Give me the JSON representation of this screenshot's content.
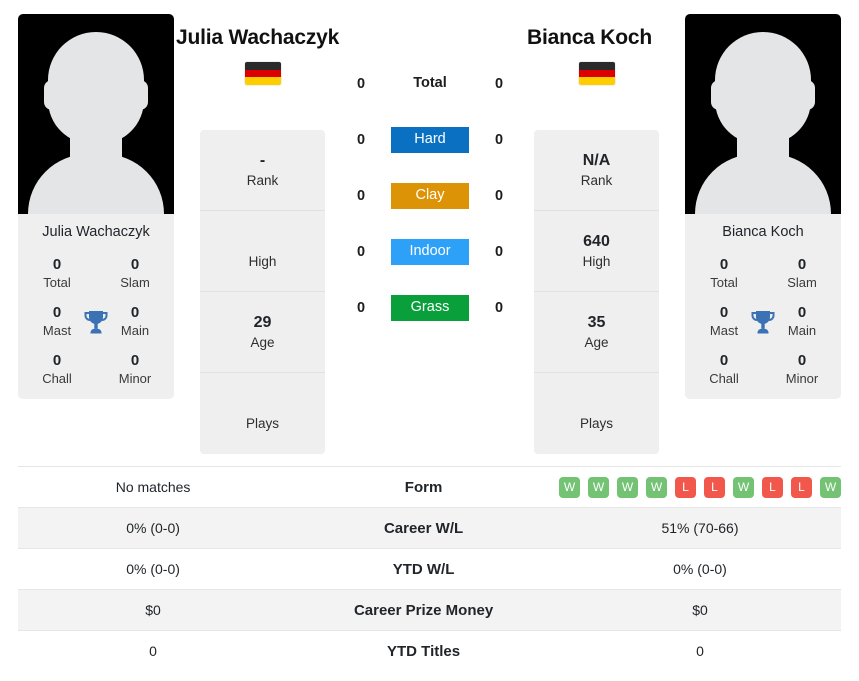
{
  "players": {
    "left": {
      "name": "Julia Wachaczyk",
      "photo_caption": "Julia Wachaczyk",
      "flag": "germany-flag",
      "avatar": "player-silhouette-avatar",
      "titles": [
        {
          "value": "0",
          "label": "Total"
        },
        {
          "value": "0",
          "label": "Slam"
        },
        {
          "value": "0",
          "label": "Mast"
        },
        {
          "value": "0",
          "label": "Main"
        },
        {
          "value": "0",
          "label": "Chall"
        },
        {
          "value": "0",
          "label": "Minor"
        }
      ],
      "info": [
        {
          "value": "-",
          "label": "Rank"
        },
        {
          "value": "",
          "label": "High"
        },
        {
          "value": "29",
          "label": "Age"
        },
        {
          "value": "",
          "label": "Plays"
        }
      ]
    },
    "right": {
      "name": "Bianca Koch",
      "photo_caption": "Bianca Koch",
      "flag": "germany-flag",
      "avatar": "player-silhouette-avatar",
      "titles": [
        {
          "value": "0",
          "label": "Total"
        },
        {
          "value": "0",
          "label": "Slam"
        },
        {
          "value": "0",
          "label": "Mast"
        },
        {
          "value": "0",
          "label": "Main"
        },
        {
          "value": "0",
          "label": "Chall"
        },
        {
          "value": "0",
          "label": "Minor"
        }
      ],
      "info": [
        {
          "value": "N/A",
          "label": "Rank"
        },
        {
          "value": "640",
          "label": "High"
        },
        {
          "value": "35",
          "label": "Age"
        },
        {
          "value": "",
          "label": "Plays"
        }
      ]
    }
  },
  "surfaces": [
    {
      "label": "Total",
      "left": "0",
      "right": "0",
      "color": "transparent",
      "style": "plain"
    },
    {
      "label": "Hard",
      "left": "0",
      "right": "0",
      "color": "#0a71c2",
      "style": "badge"
    },
    {
      "label": "Clay",
      "left": "0",
      "right": "0",
      "color": "#dd9306",
      "style": "badge"
    },
    {
      "label": "Indoor",
      "left": "0",
      "right": "0",
      "color": "#2da1f8",
      "style": "badge"
    },
    {
      "label": "Grass",
      "left": "0",
      "right": "0",
      "color": "#09a03b",
      "style": "badge"
    }
  ],
  "stats_rows": [
    {
      "label": "Form",
      "left_text": "No matches",
      "right_text": "",
      "right_form": [
        "W",
        "W",
        "W",
        "W",
        "L",
        "L",
        "W",
        "L",
        "L",
        "W"
      ],
      "shaded": false
    },
    {
      "label": "Career W/L",
      "left_text": "0% (0-0)",
      "right_text": "51% (70-66)",
      "shaded": true
    },
    {
      "label": "YTD W/L",
      "left_text": "0% (0-0)",
      "right_text": "0% (0-0)",
      "shaded": false
    },
    {
      "label": "Career Prize Money",
      "left_text": "$0",
      "right_text": "$0",
      "shaded": true
    },
    {
      "label": "YTD Titles",
      "left_text": "0",
      "right_text": "0",
      "shaded": false
    }
  ],
  "colors": {
    "hard": "#0a71c2",
    "clay": "#dd9306",
    "indoor": "#2da1f8",
    "grass": "#09a03b",
    "win": "#74c274",
    "loss": "#f1584b",
    "trophy": "#3b72b5",
    "card_bg": "#efefef"
  },
  "icons": {
    "trophy": "trophy-icon"
  }
}
